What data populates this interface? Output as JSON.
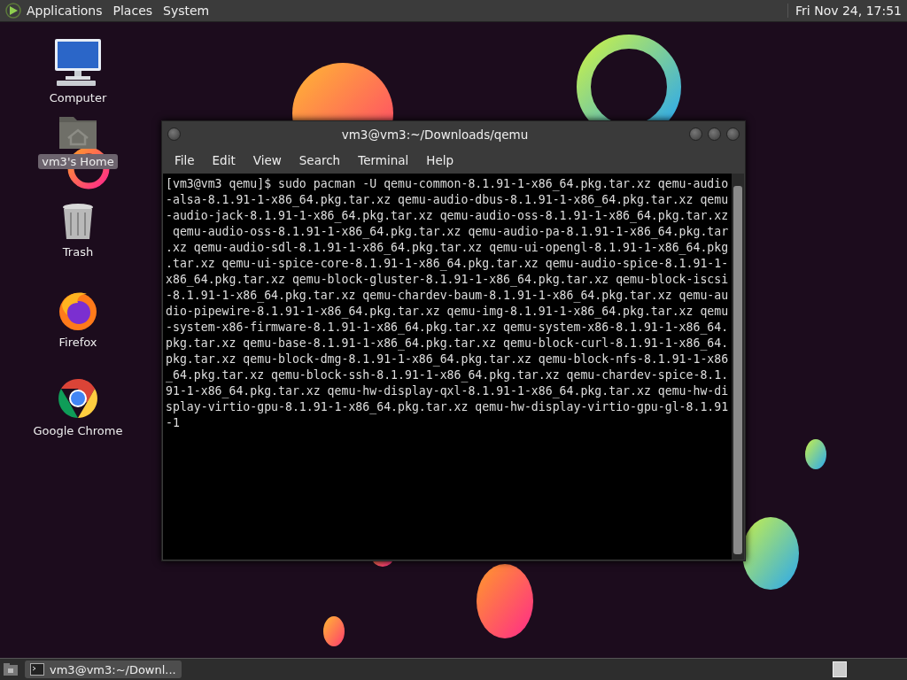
{
  "top_panel": {
    "menus": [
      "Applications",
      "Places",
      "System"
    ],
    "clock": "Fri Nov 24, 17:51"
  },
  "desktop_icons": [
    {
      "label": "Computer",
      "kind": "computer",
      "selected": false
    },
    {
      "label": "vm3's Home",
      "kind": "home",
      "selected": true
    },
    {
      "label": "Trash",
      "kind": "trash",
      "selected": false
    },
    {
      "label": "Firefox",
      "kind": "firefox",
      "selected": false
    },
    {
      "label": "Google Chrome",
      "kind": "chrome",
      "selected": false
    }
  ],
  "terminal_window": {
    "title": "vm3@vm3:~/Downloads/qemu",
    "menu": [
      "File",
      "Edit",
      "View",
      "Search",
      "Terminal",
      "Help"
    ],
    "lines": [
      "[vm3@vm3 qemu]$ sudo pacman -U qemu-common-8.1.91-1-x86_64.pkg.tar.xz qemu-audio",
      "-alsa-8.1.91-1-x86_64.pkg.tar.xz qemu-audio-dbus-8.1.91-1-x86_64.pkg.tar.xz qemu",
      "-audio-jack-8.1.91-1-x86_64.pkg.tar.xz qemu-audio-oss-8.1.91-1-x86_64.pkg.tar.xz",
      " qemu-audio-oss-8.1.91-1-x86_64.pkg.tar.xz qemu-audio-pa-8.1.91-1-x86_64.pkg.tar",
      ".xz qemu-audio-sdl-8.1.91-1-x86_64.pkg.tar.xz qemu-ui-opengl-8.1.91-1-x86_64.pkg",
      ".tar.xz qemu-ui-spice-core-8.1.91-1-x86_64.pkg.tar.xz qemu-audio-spice-8.1.91-1-",
      "x86_64.pkg.tar.xz qemu-block-gluster-8.1.91-1-x86_64.pkg.tar.xz qemu-block-iscsi",
      "-8.1.91-1-x86_64.pkg.tar.xz qemu-chardev-baum-8.1.91-1-x86_64.pkg.tar.xz qemu-au",
      "dio-pipewire-8.1.91-1-x86_64.pkg.tar.xz qemu-img-8.1.91-1-x86_64.pkg.tar.xz qemu",
      "-system-x86-firmware-8.1.91-1-x86_64.pkg.tar.xz qemu-system-x86-8.1.91-1-x86_64.",
      "pkg.tar.xz qemu-base-8.1.91-1-x86_64.pkg.tar.xz qemu-block-curl-8.1.91-1-x86_64.",
      "pkg.tar.xz qemu-block-dmg-8.1.91-1-x86_64.pkg.tar.xz qemu-block-nfs-8.1.91-1-x86",
      "_64.pkg.tar.xz qemu-block-ssh-8.1.91-1-x86_64.pkg.tar.xz qemu-chardev-spice-8.1.",
      "91-1-x86_64.pkg.tar.xz qemu-hw-display-qxl-8.1.91-1-x86_64.pkg.tar.xz qemu-hw-di",
      "splay-virtio-gpu-8.1.91-1-x86_64.pkg.tar.xz qemu-hw-display-virtio-gpu-gl-8.1.91",
      "-1"
    ]
  },
  "taskbar": {
    "tasks": [
      {
        "label": "vm3@vm3:~/Downl...",
        "selected": true
      }
    ]
  }
}
